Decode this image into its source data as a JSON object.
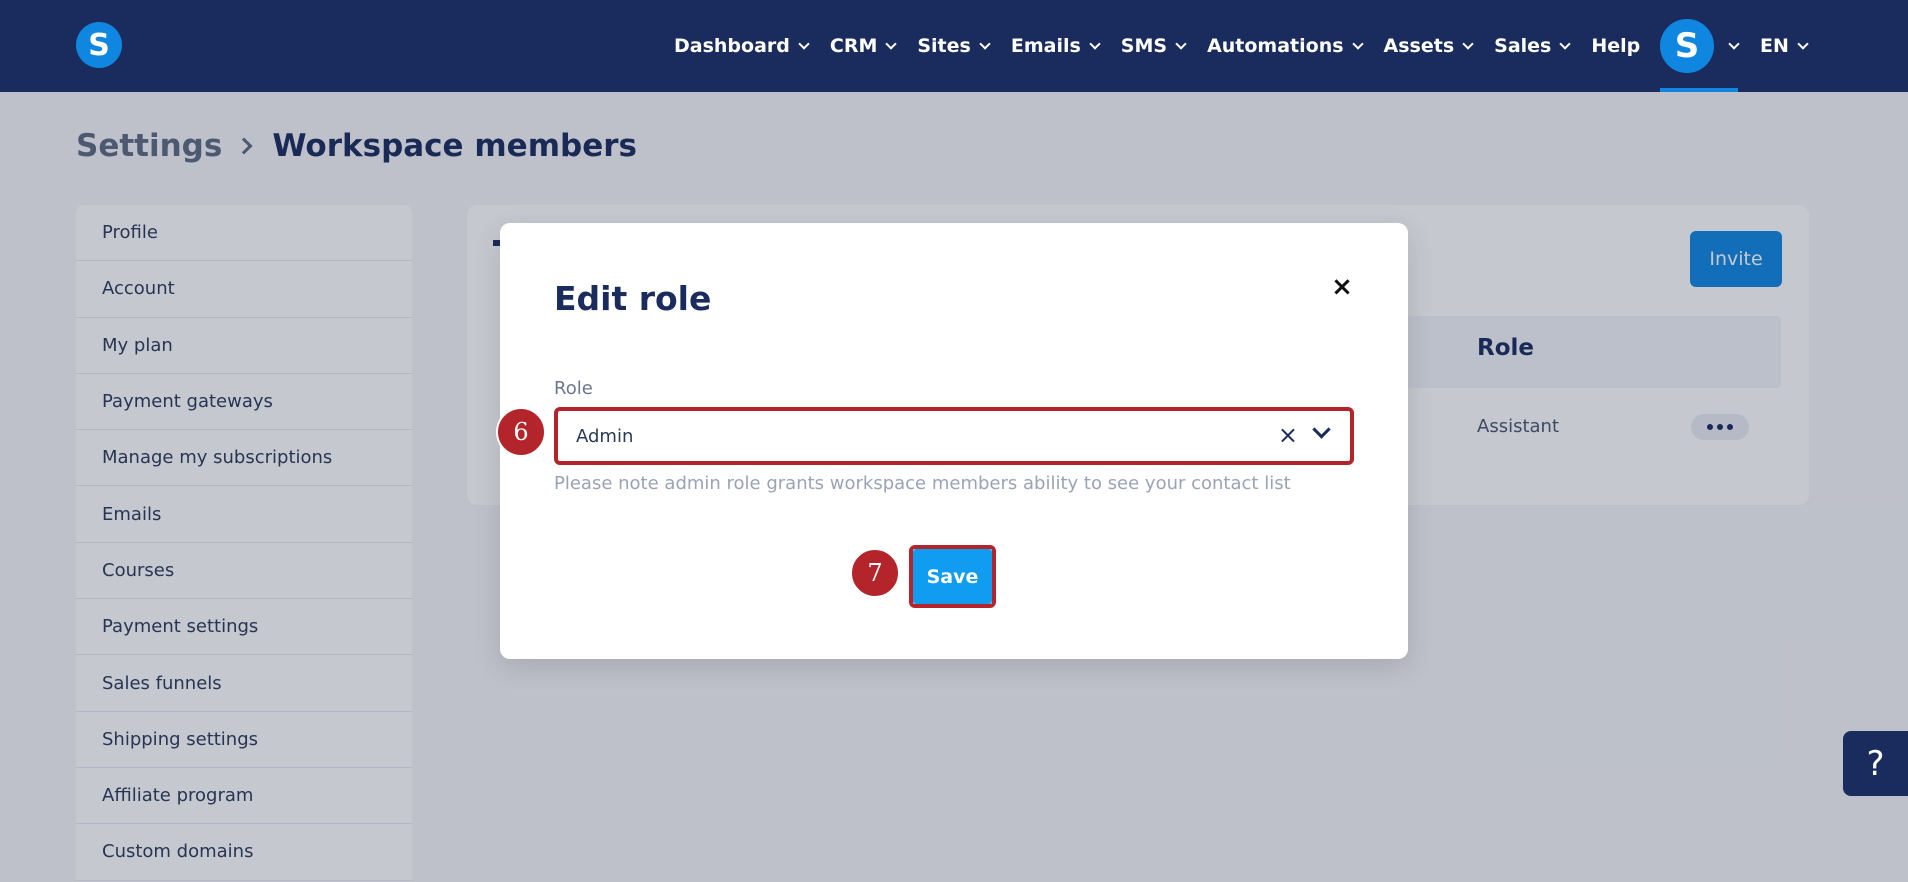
{
  "nav": {
    "items": [
      {
        "label": "Dashboard",
        "chevron": true
      },
      {
        "label": "CRM",
        "chevron": true
      },
      {
        "label": "Sites",
        "chevron": true
      },
      {
        "label": "Emails",
        "chevron": true
      },
      {
        "label": "SMS",
        "chevron": true
      },
      {
        "label": "Automations",
        "chevron": true
      },
      {
        "label": "Assets",
        "chevron": true
      },
      {
        "label": "Sales",
        "chevron": true
      },
      {
        "label": "Help",
        "chevron": false
      }
    ],
    "logo_letter": "S",
    "avatar_letter": "S",
    "language": "EN",
    "icons": [
      "bell-icon"
    ]
  },
  "breadcrumb": {
    "parent": "Settings",
    "current": "Workspace members"
  },
  "sidebar": {
    "items": [
      {
        "label": "Profile"
      },
      {
        "label": "Account"
      },
      {
        "label": "My plan"
      },
      {
        "label": "Payment gateways"
      },
      {
        "label": "Manage my subscriptions"
      },
      {
        "label": "Emails"
      },
      {
        "label": "Courses"
      },
      {
        "label": "Payment settings"
      },
      {
        "label": "Sales funnels"
      },
      {
        "label": "Shipping settings"
      },
      {
        "label": "Affiliate program"
      },
      {
        "label": "Custom domains"
      }
    ]
  },
  "members": {
    "invite_label": "Invite",
    "role_column": "Role",
    "row": {
      "role": "Assistant"
    }
  },
  "modal": {
    "title": "Edit role",
    "close": "×",
    "role_label": "Role",
    "role_value": "Admin",
    "clear": "×",
    "helper": "Please note admin role grants workspace members ability to see your contact list",
    "save_label": "Save"
  },
  "steps": {
    "select_step": "6",
    "save_step": "7"
  },
  "help_fab": "?",
  "colors": {
    "topbar": "#1a2c5e",
    "accent": "#0f87e0",
    "highlight": "#b3252a"
  }
}
